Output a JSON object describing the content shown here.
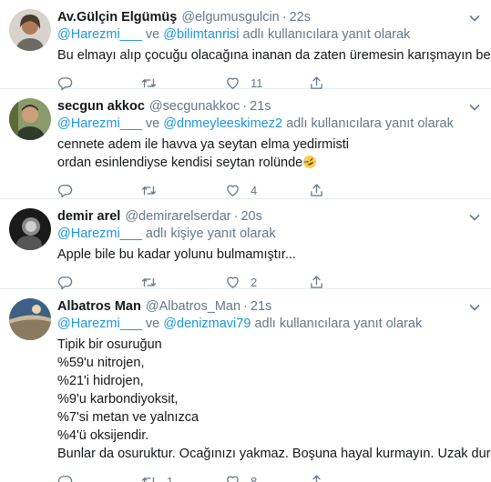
{
  "icons": {
    "reply": "reply-icon",
    "retweet": "retweet-icon",
    "like": "heart-icon",
    "share": "share-icon",
    "more": "chevron-down-icon"
  },
  "colors": {
    "link": "#1b95e0",
    "muted": "#657786",
    "text": "#14171a",
    "divider": "#e6ecf0"
  },
  "tweets": [
    {
      "name": "Av.Gülçin Elgümüş",
      "handle": "@elgumusgulcin",
      "time": "22s",
      "reply_mentions": [
        "@Harezmi___",
        "@bilimtanrisi"
      ],
      "reply_joiner": "ve",
      "reply_suffix": "adlı kullanıcılara yanıt olarak",
      "lines": [
        "Bu elmayı alıp çocuğu olacağına inanan da zaten üremesin karışmayın bence"
      ],
      "reply_count": "",
      "retweet_count": "",
      "like_count": "11"
    },
    {
      "name": "secgun akkoc",
      "handle": "@secgunakkoc",
      "time": "21s",
      "reply_mentions": [
        "@Harezmi___",
        "@dnmeyleeskimez2"
      ],
      "reply_joiner": "ve",
      "reply_suffix": "adlı kullanıcılara yanıt olarak",
      "lines": [
        "cennete adem ile havva ya seytan elma yedirmisti",
        "ordan esinlendiyse kendisi seytan rolünde"
      ],
      "emoji": "rolling-on-floor-laughing-emoji",
      "reply_count": "",
      "retweet_count": "",
      "like_count": "4"
    },
    {
      "name": "demir arel",
      "handle": "@demirarelserdar",
      "time": "20s",
      "reply_mentions": [
        "@Harezmi___"
      ],
      "reply_suffix": "adlı kişiye yanıt olarak",
      "lines": [
        "Apple bile bu kadar yolunu bulmamıştır..."
      ],
      "reply_count": "",
      "retweet_count": "",
      "like_count": "2"
    },
    {
      "name": "Albatros Man",
      "handle": "@Albatros_Man",
      "time": "21s",
      "reply_mentions": [
        "@Harezmi___",
        "@denizmavi79"
      ],
      "reply_joiner": "ve",
      "reply_suffix": "adlı kullanıcılara yanıt olarak",
      "lines": [
        "Tipik bir osuruğun",
        "%59'u nitrojen,",
        "%21'i hidrojen,",
        "%9'u karbondiyoksit,",
        "%7'si metan ve yalnızca",
        "%4'ü oksijendir.",
        "Bunlar da osuruktur. Ocağınızı yakmaz. Boşuna hayal kurmayın. Uzak durun."
      ],
      "reply_count": "",
      "retweet_count": "1",
      "like_count": "8"
    }
  ]
}
